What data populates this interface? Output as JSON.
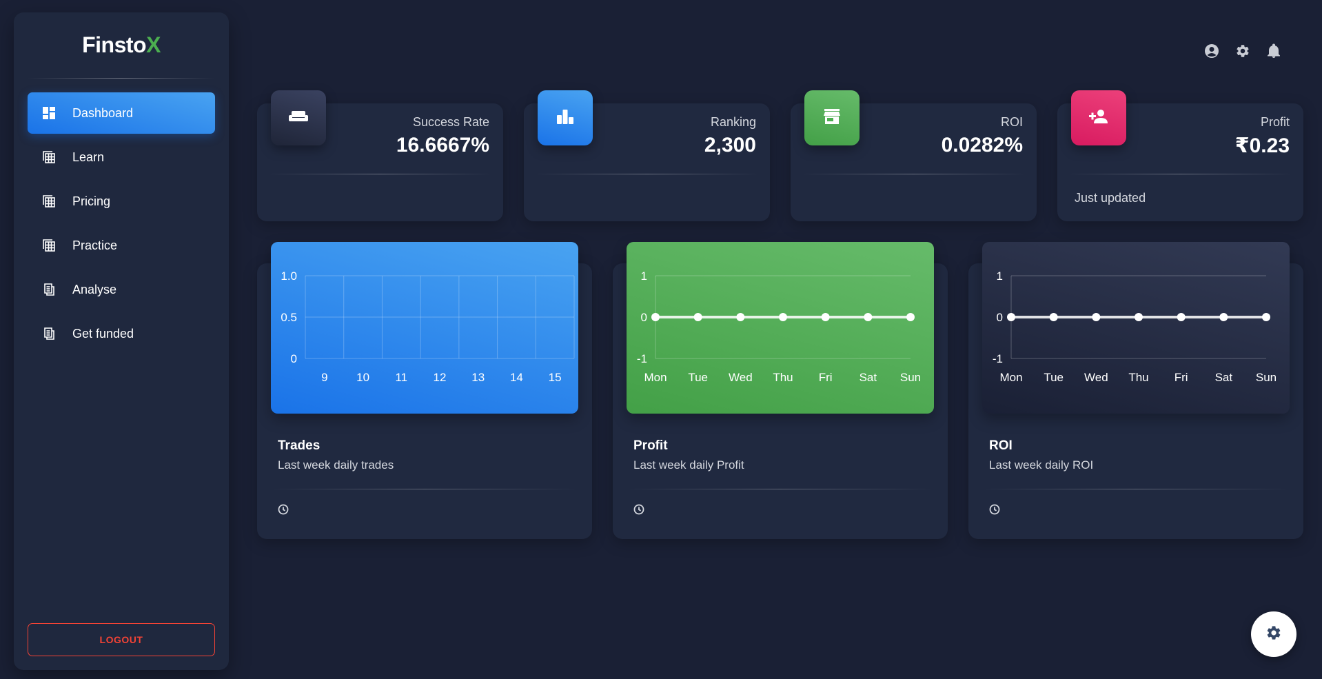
{
  "brand": {
    "name_main": "Finsto",
    "name_accent": "X",
    "accent_color": "#4caf50"
  },
  "sidebar": {
    "items": [
      {
        "label": "Dashboard",
        "icon": "dashboard-icon",
        "active": true
      },
      {
        "label": "Learn",
        "icon": "table-view-icon",
        "active": false
      },
      {
        "label": "Pricing",
        "icon": "table-view-icon",
        "active": false
      },
      {
        "label": "Practice",
        "icon": "table-view-icon",
        "active": false
      },
      {
        "label": "Analyse",
        "icon": "receipt-icon",
        "active": false
      },
      {
        "label": "Get funded",
        "icon": "receipt-icon",
        "active": false
      }
    ],
    "logout_label": "LOGOUT"
  },
  "header": {
    "icons": [
      "account-circle-icon",
      "settings-icon",
      "notifications-icon"
    ]
  },
  "stats": [
    {
      "label": "Success Rate",
      "value": "16.6667%",
      "icon": "weekend-icon",
      "color": "#323a54",
      "footer": ""
    },
    {
      "label": "Ranking",
      "value": "2,300",
      "icon": "leaderboard-icon",
      "color": "#1a73e8",
      "footer": ""
    },
    {
      "label": "ROI",
      "value": "0.0282%",
      "icon": "store-icon",
      "color": "#4caf50",
      "footer": ""
    },
    {
      "label": "Profit",
      "value": "₹0.23",
      "icon": "person-add-icon",
      "color": "#e91e63",
      "footer": "Just updated"
    }
  ],
  "charts": [
    {
      "title": "Trades",
      "subtitle": "Last week daily trades",
      "footer_icon": "clock-icon",
      "panel_color": "#1a73e8"
    },
    {
      "title": "Profit",
      "subtitle": "Last week daily Profit",
      "footer_icon": "clock-icon",
      "panel_color": "#4caf50"
    },
    {
      "title": "ROI",
      "subtitle": "Last week daily ROI",
      "footer_icon": "clock-icon",
      "panel_color": "#323a54"
    }
  ],
  "chart_data": [
    {
      "type": "bar",
      "title": "",
      "categories": [
        "9",
        "10",
        "11",
        "12",
        "13",
        "14",
        "15"
      ],
      "values": [
        0,
        0,
        0,
        0,
        0,
        0,
        0
      ],
      "yticks": [
        "0",
        "0.5",
        "1.0"
      ],
      "ylim": [
        0,
        1
      ],
      "grid": true
    },
    {
      "type": "line",
      "title": "",
      "categories": [
        "Mon",
        "Tue",
        "Wed",
        "Thu",
        "Fri",
        "Sat",
        "Sun"
      ],
      "values": [
        0,
        0,
        0,
        0,
        0,
        0,
        0
      ],
      "yticks": [
        "-1",
        "0",
        "1"
      ],
      "ylim": [
        -1,
        1
      ],
      "grid": true
    },
    {
      "type": "line",
      "title": "",
      "categories": [
        "Mon",
        "Tue",
        "Wed",
        "Thu",
        "Fri",
        "Sat",
        "Sun"
      ],
      "values": [
        0,
        0,
        0,
        0,
        0,
        0,
        0
      ],
      "yticks": [
        "-1",
        "0",
        "1"
      ],
      "ylim": [
        -1,
        1
      ],
      "grid": true
    }
  ],
  "fab": {
    "icon": "settings-icon"
  }
}
